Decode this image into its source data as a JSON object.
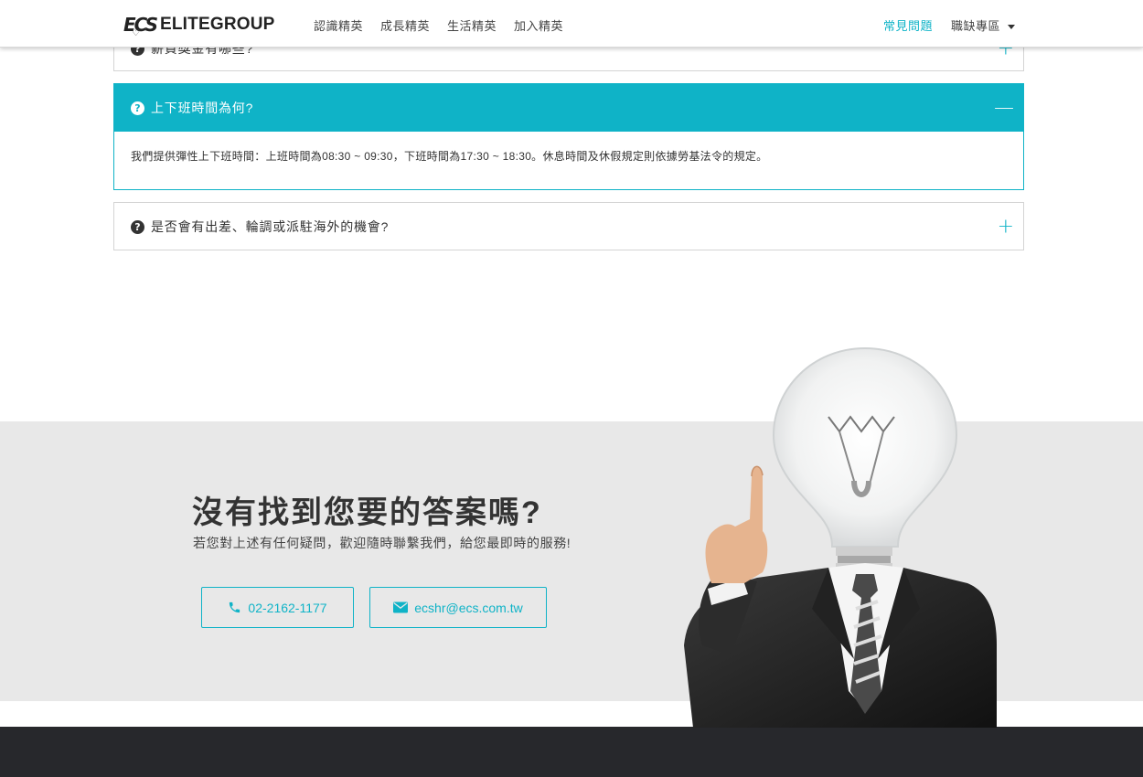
{
  "header": {
    "logo_mark": "ECS",
    "logo_text": "ELITEGROUP",
    "nav": [
      "認識精英",
      "成長精英",
      "生活精英",
      "加入精英"
    ],
    "faq_label": "常見問題",
    "jobs_label": "職缺專區"
  },
  "faq": {
    "items": [
      {
        "question": "薪資獎金有哪些?",
        "toggle": "+"
      },
      {
        "question": "上下班時間為何?",
        "toggle": "—",
        "answer": "我們提供彈性上下班時間：上班時間為08:30 ~ 09:30，下班時間為17:30 ~ 18:30。休息時間及休假規定則依據勞基法令的規定。"
      },
      {
        "question": "是否會有出差、輪調或派駐海外的機會?",
        "toggle": "+"
      }
    ]
  },
  "contact": {
    "title": "沒有找到您要的答案嗎?",
    "subtitle": "若您對上述有任何疑問，歡迎隨時聯繫我們，給您最即時的服務!",
    "phone": "02-2162-1177",
    "email": "ecshr@ecs.com.tw"
  },
  "colors": {
    "accent": "#0fb3c7",
    "band": "#e8e8e8",
    "footer": "#27282c"
  }
}
